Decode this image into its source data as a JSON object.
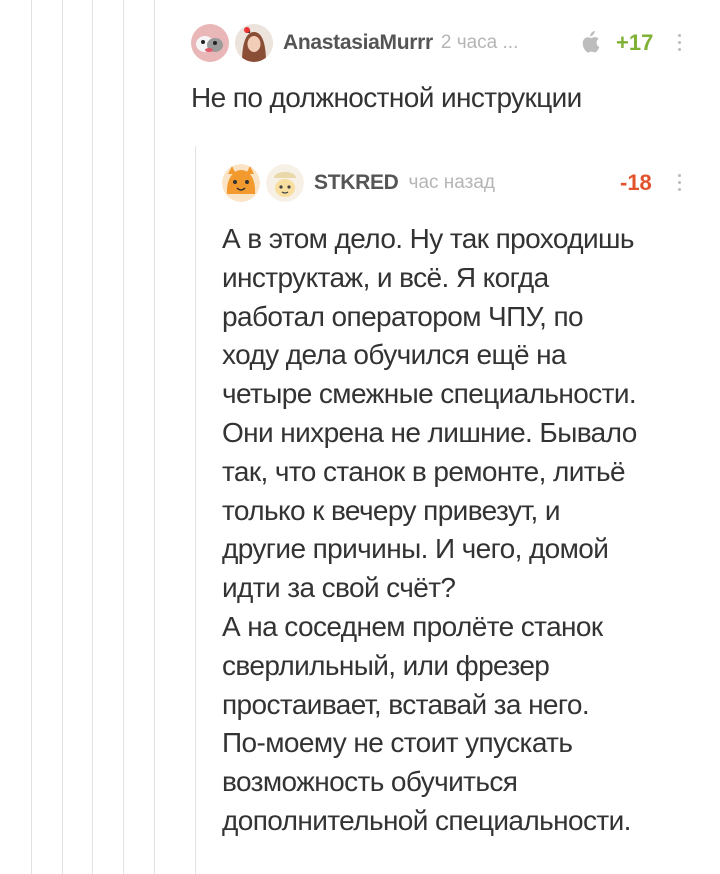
{
  "comments": [
    {
      "author": "AnastasiaMurrr",
      "time": "2 часа ...",
      "rating": "+17",
      "rating_color": "#7fb135",
      "device_icon": "apple-icon",
      "text": "Не по должностной инструкции"
    },
    {
      "author": "STKRED",
      "time": "час назад",
      "rating": "-18",
      "rating_color": "#e2532d",
      "text": "А в этом дело. Ну так проходишь\nинструктаж, и всё. Я когда\nработал оператором ЧПУ, по\nходу дела обучился ещё на\nчетыре смежные специальности.\nОни нихрена не лишние. Бывало\nтак, что станок в ремонте, литьё\nтолько к вечеру привезут, и\nдругие причины. И чего, домой\nидти за свой счёт?\nА на соседнем пролёте станок\nсверлильный, или фрезер\nпростаивает, вставай за него.\nПо-моему не стоит упускать\nвозможность обучиться\nдополнительной специальности."
    }
  ]
}
